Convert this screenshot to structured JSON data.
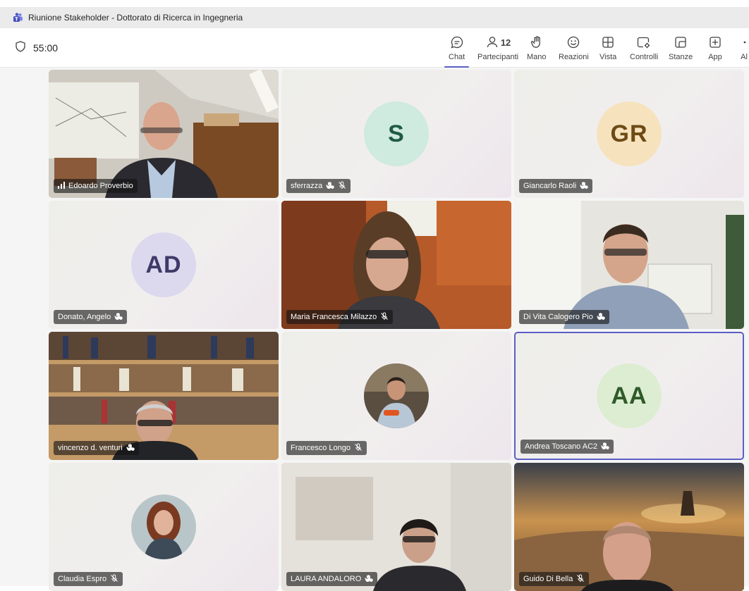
{
  "window": {
    "title": "Riunione Stakeholder - Dottorato di Ricerca in Ingegneria"
  },
  "meeting": {
    "timer": "55:00"
  },
  "toolbar": {
    "chat": "Chat",
    "participants": "Partecipanti",
    "participants_count": "12",
    "hand": "Mano",
    "reactions": "Reazioni",
    "view": "Vista",
    "controls": "Controlli",
    "rooms": "Stanze",
    "apps": "App",
    "more": "Al"
  },
  "tiles": [
    {
      "name": "Edoardo Proverbio",
      "type": "video",
      "status": "speaking"
    },
    {
      "name": "sferrazza",
      "type": "initials",
      "initials": "S",
      "avatar_bg": "#cfeadf",
      "avatar_fg": "#1e5a45",
      "status": "muted"
    },
    {
      "name": "Giancarlo Raoli",
      "type": "initials",
      "initials": "GR",
      "avatar_bg": "#f6e2bd",
      "avatar_fg": "#6d4a15",
      "status": "raised-hand"
    },
    {
      "name": "Donato, Angelo",
      "type": "initials",
      "initials": "AD",
      "avatar_bg": "#dcd8ee",
      "avatar_fg": "#3f3a68",
      "status": "raised-hand"
    },
    {
      "name": "Maria Francesca Milazzo",
      "type": "video",
      "status": "muted"
    },
    {
      "name": "Di Vita Calogero Pio",
      "type": "video",
      "status": "raised-hand"
    },
    {
      "name": "vincenzo d. venturi",
      "type": "video",
      "status": "raised-hand"
    },
    {
      "name": "Francesco Longo",
      "type": "photo",
      "status": "muted"
    },
    {
      "name": "Andrea Toscano AC2",
      "type": "initials",
      "initials": "AA",
      "avatar_bg": "#dcedd2",
      "avatar_fg": "#2f5a2a",
      "status": "raised-hand",
      "selected": true
    },
    {
      "name": "Claudia Espro",
      "type": "photo",
      "status": "muted"
    },
    {
      "name": "LAURA ANDALORO",
      "type": "video",
      "status": "raised-hand"
    },
    {
      "name": "Guido Di Bella",
      "type": "video",
      "status": "muted"
    }
  ],
  "colors": {
    "accent": "#5b5fc7",
    "titlebar_bg": "#ebebeb",
    "nametag_bg": "#141414"
  },
  "icons": [
    "teams-icon",
    "shield-icon",
    "chat-icon",
    "people-icon",
    "hand-icon",
    "emoji-icon",
    "grid-view-icon",
    "controls-icon",
    "rooms-icon",
    "apps-icon",
    "more-icon",
    "mic-off-icon",
    "raised-hand-icon",
    "signal-icon"
  ]
}
